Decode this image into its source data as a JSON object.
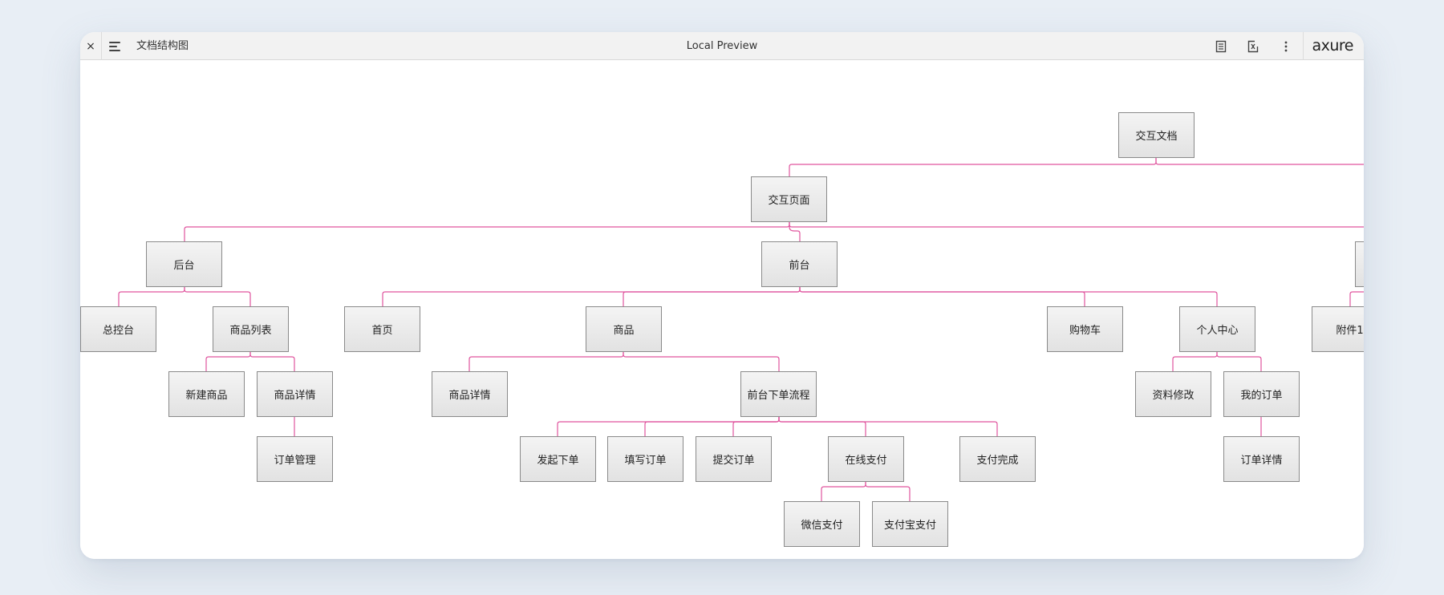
{
  "toolbar": {
    "close_glyph": "×",
    "page_name": "文档结构图",
    "title": "Local Preview",
    "logo": "axure"
  },
  "colors": {
    "connector": "#e0559e",
    "node_border": "#8a8a8a",
    "background": "#e8eef5"
  },
  "tree": {
    "root": "交互文档",
    "pages": "交互页面",
    "backend": {
      "label": "后台",
      "children": [
        "总控台",
        "商品列表"
      ],
      "product_list_children": [
        "新建商品",
        "商品详情"
      ],
      "product_detail_children": [
        "订单管理"
      ]
    },
    "frontend": {
      "label": "前台",
      "children": [
        "首页",
        "商品",
        "购物车",
        "个人中心"
      ],
      "product_children": [
        "商品详情",
        "前台下单流程"
      ],
      "order_flow_children": [
        "发起下单",
        "填写订单",
        "提交订单",
        "在线支付",
        "支付完成"
      ],
      "online_pay_children": [
        "微信支付",
        "支付宝支付"
      ],
      "user_center_children": [
        "资料修改",
        "我的订单"
      ],
      "my_orders_children": [
        "订单详情"
      ]
    },
    "attachments": {
      "children": [
        "附件1"
      ]
    }
  }
}
